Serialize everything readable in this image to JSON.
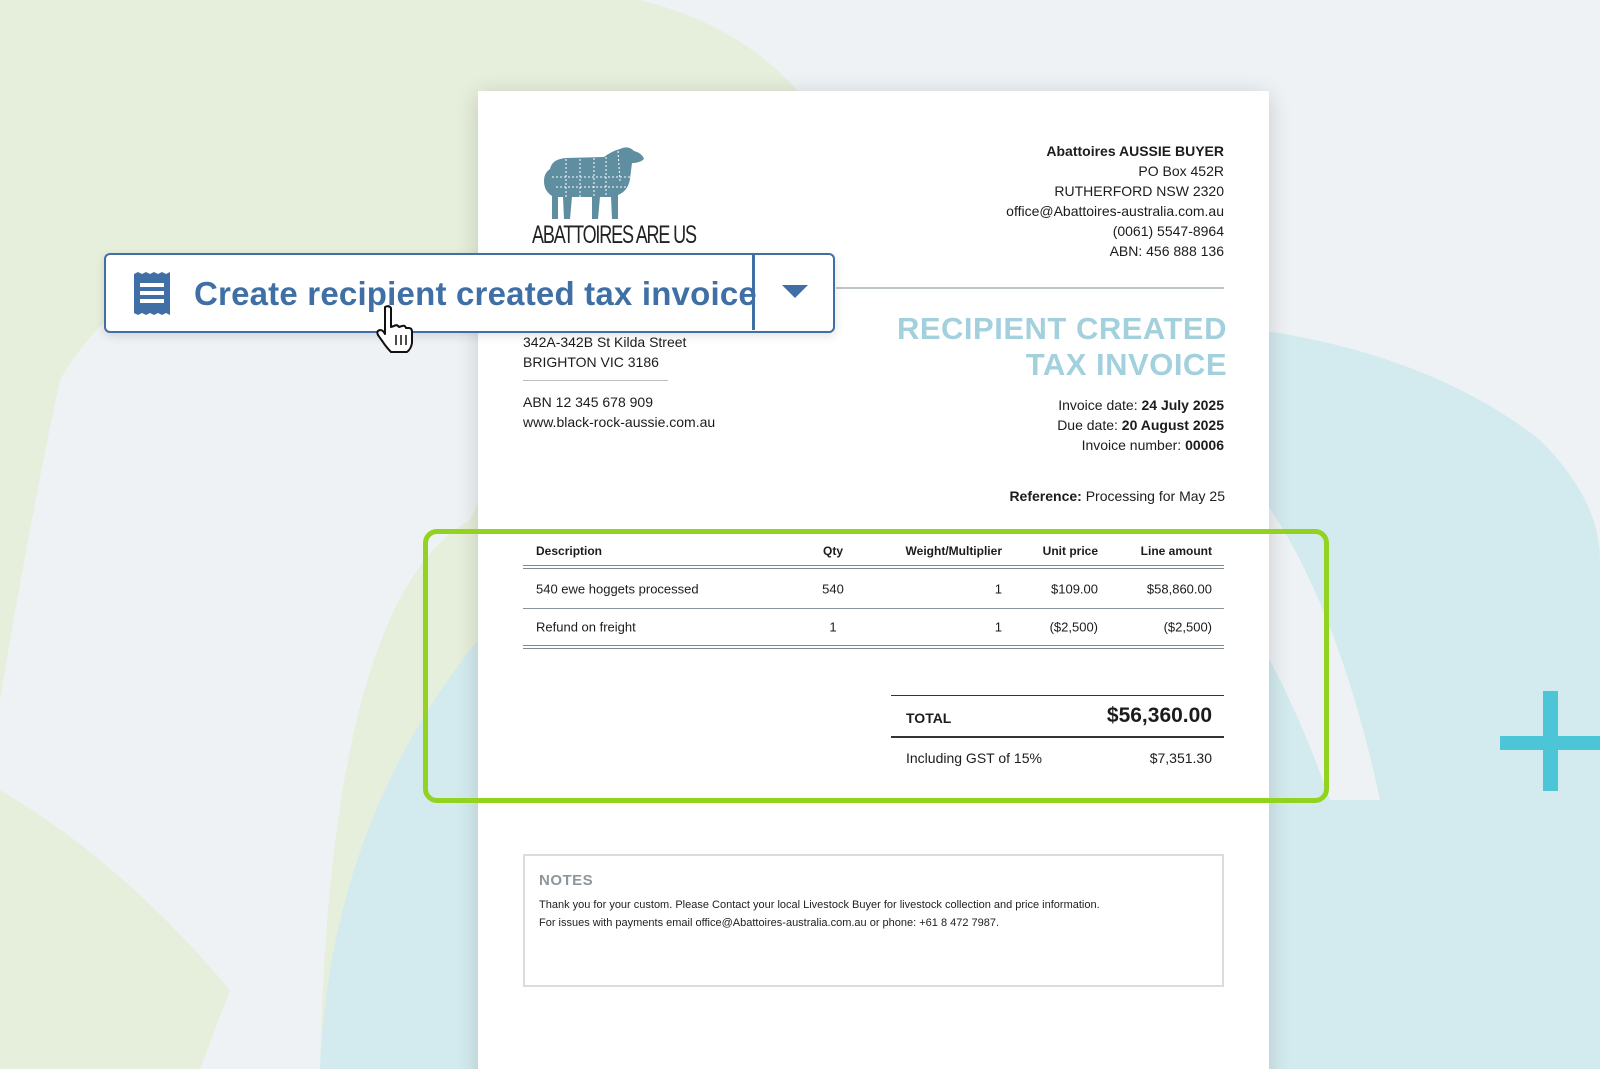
{
  "action_button": {
    "label": "Create recipient created tax invoice",
    "icon": "invoice-icon",
    "dropdown_icon": "caret-down-icon",
    "color": "#3f6fa5"
  },
  "invoice": {
    "logo": {
      "icon": "sheep-icon",
      "text": "ABATTOIRES ARE US"
    },
    "buyer": {
      "name": "Abattoires AUSSIE BUYER",
      "lines": [
        "PO Box 452R",
        "RUTHERFORD NSW 2320",
        "office@Abattoires-australia.com.au",
        "(0061) 5547-8964",
        "ABN: 456 888 136"
      ]
    },
    "supplier": {
      "address1": "342A-342B St Kilda Street",
      "address2": "BRIGHTON VIC 3186",
      "abn": "ABN 12 345 678 909",
      "website": "www.black-rock-aussie.com.au"
    },
    "title_line1": "RECIPIENT CREATED",
    "title_line2": "TAX INVOICE",
    "title_color": "#a3d0dd",
    "meta": {
      "invoice_date_label": "Invoice date:",
      "invoice_date": "24 July 2025",
      "due_date_label": "Due date:",
      "due_date": "20 August 2025",
      "invoice_number_label": "Invoice number:",
      "invoice_number": "00006"
    },
    "reference": {
      "label": "Reference:",
      "value": "Processing for May 25"
    },
    "table": {
      "headers": {
        "description": "Description",
        "qty": "Qty",
        "weight": "Weight/Multiplier",
        "unit_price": "Unit price",
        "line_amount": "Line amount"
      },
      "rows": [
        {
          "description": "540 ewe hoggets processed",
          "qty": "540",
          "weight": "1",
          "unit_price": "$109.00",
          "line_amount": "$58,860.00"
        },
        {
          "description": "Refund on freight",
          "qty": "1",
          "weight": "1",
          "unit_price": "($2,500)",
          "line_amount": "($2,500)"
        }
      ]
    },
    "total": {
      "label": "TOTAL",
      "value": "$56,360.00",
      "gst_label": "Including GST of 15%",
      "gst_value": "$7,351.30"
    },
    "notes": {
      "title": "NOTES",
      "line1": "Thank you for your custom. Please Contact your local Livestock Buyer for livestock collection and price information.",
      "line2": "For issues with payments email office@Abattoires-australia.com.au or phone: +61 8 472 7987."
    }
  },
  "highlight_color": "#92d31f",
  "cursor_icon": "hand-pointer-icon",
  "plus_icon": "plus-icon"
}
